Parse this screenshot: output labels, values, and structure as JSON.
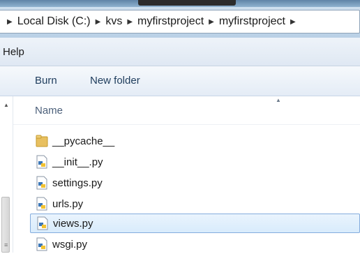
{
  "address": {
    "breadcrumbs": [
      "Local Disk (C:)",
      "kvs",
      "myfirstproject",
      "myfirstproject"
    ]
  },
  "menu": {
    "help_label": "Help"
  },
  "toolbar": {
    "burn_label": "Burn",
    "new_folder_label": "New folder"
  },
  "columns": {
    "name_label": "Name"
  },
  "files": [
    {
      "name": "__pycache__",
      "type": "folder",
      "selected": false
    },
    {
      "name": "__init__.py",
      "type": "python",
      "selected": false
    },
    {
      "name": "settings.py",
      "type": "python",
      "selected": false
    },
    {
      "name": "urls.py",
      "type": "python",
      "selected": false
    },
    {
      "name": "views.py",
      "type": "python",
      "selected": true
    },
    {
      "name": "wsgi.py",
      "type": "python",
      "selected": false
    }
  ],
  "icons": {
    "separator": "chevron-right-icon",
    "folder": "folder-icon",
    "python": "python-file-icon"
  },
  "colors": {
    "selection_fill": "#d8ebfc",
    "selection_border": "#84acdd",
    "folder": "#e8c060"
  }
}
